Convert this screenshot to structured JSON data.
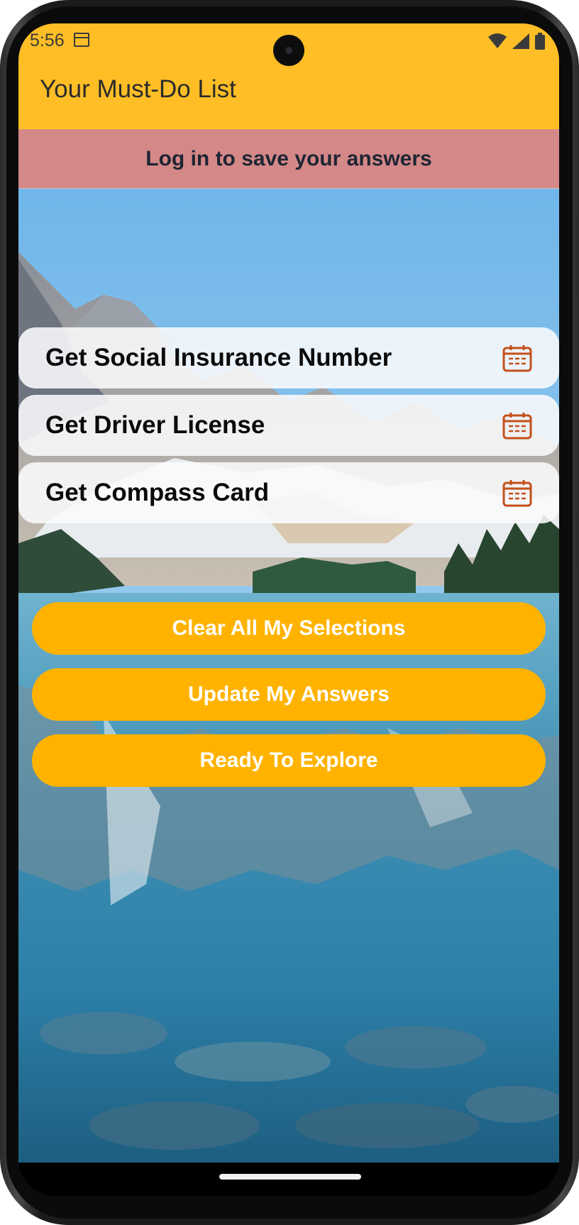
{
  "status_bar": {
    "time": "5:56",
    "icons": [
      "calendar-icon",
      "wifi-icon",
      "signal-icon",
      "battery-icon"
    ]
  },
  "app_bar": {
    "title": "Your Must-Do List"
  },
  "banner": {
    "text": "Log in to save your answers"
  },
  "tasks": [
    {
      "label": "Get Social Insurance Number",
      "icon": "calendar-icon"
    },
    {
      "label": "Get Driver License",
      "icon": "calendar-icon"
    },
    {
      "label": "Get Compass Card",
      "icon": "calendar-icon"
    }
  ],
  "actions": {
    "clear_label": "Clear All My Selections",
    "update_label": "Update My Answers",
    "explore_label": "Ready To Explore"
  },
  "colors": {
    "app_bar": "#FFBE26",
    "banner": "#D48888",
    "button": "#FFB300",
    "calendar_icon": "#C4501A"
  }
}
